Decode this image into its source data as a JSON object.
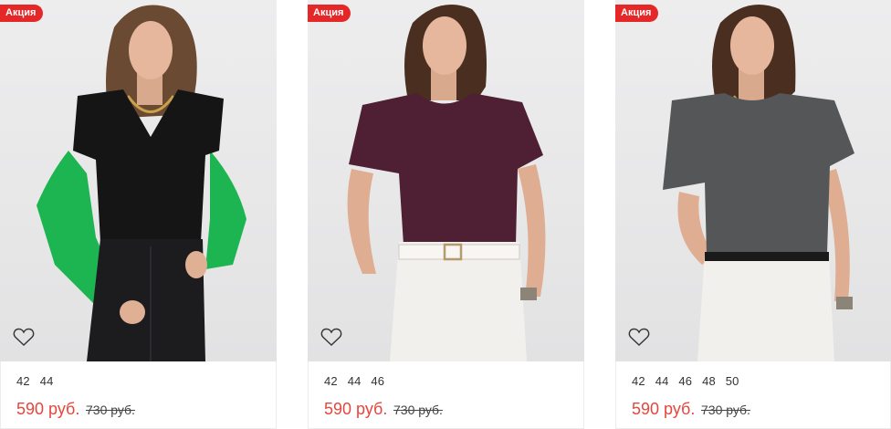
{
  "products": [
    {
      "badge": "Акция",
      "sizes": [
        "42",
        "44"
      ],
      "price": "590 руб.",
      "old_price": "730 руб.",
      "top_color": "#151515",
      "accent_color": "#1db552"
    },
    {
      "badge": "Акция",
      "sizes": [
        "42",
        "44",
        "46"
      ],
      "price": "590 руб.",
      "old_price": "730 руб.",
      "top_color": "#4f1f33",
      "accent_color": "#f2f0ec"
    },
    {
      "badge": "Акция",
      "sizes": [
        "42",
        "44",
        "46",
        "48",
        "50"
      ],
      "price": "590 руб.",
      "old_price": "730 руб.",
      "top_color": "#545658",
      "accent_color": "#f2f0ec"
    }
  ],
  "icons": {
    "wishlist": "heart-icon"
  },
  "colors": {
    "badge": "#e62727",
    "price": "#e4473c"
  }
}
